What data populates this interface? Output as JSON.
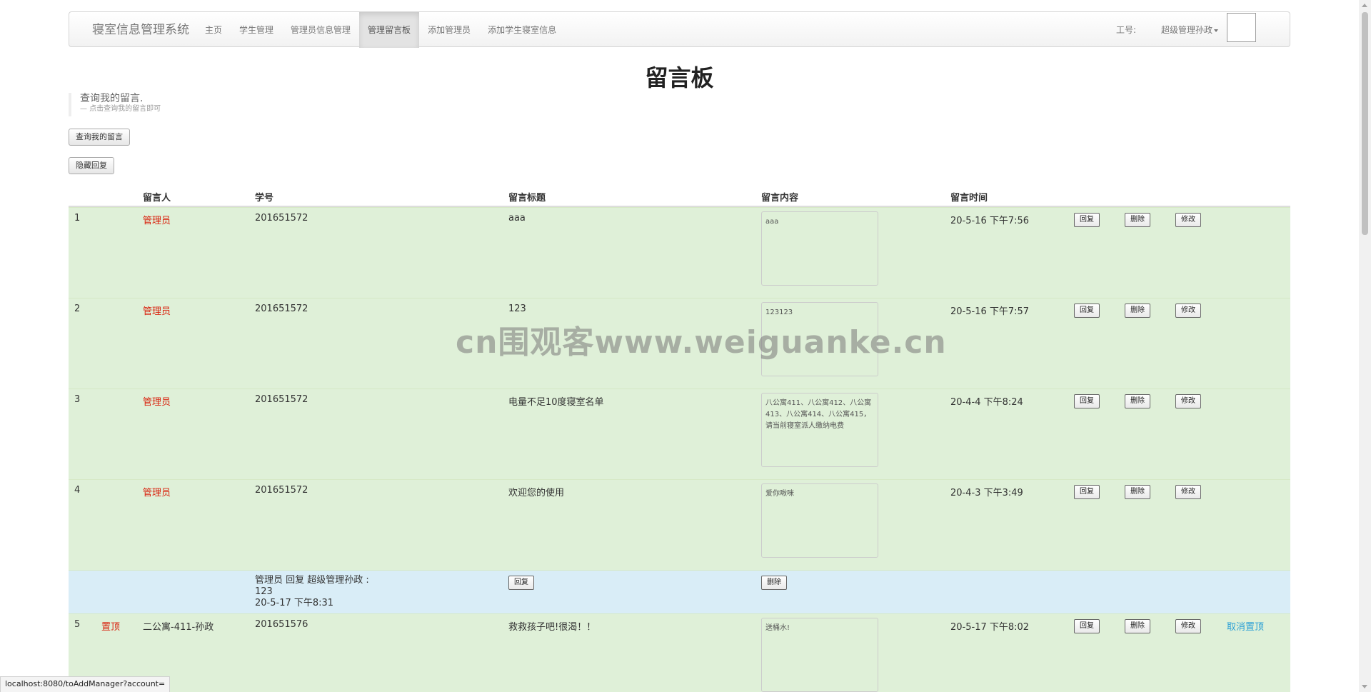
{
  "navbar": {
    "brand": "寝室信息管理系统",
    "items": [
      {
        "label": "主页"
      },
      {
        "label": "学生管理"
      },
      {
        "label": "管理员信息管理"
      },
      {
        "label": "管理留言板"
      },
      {
        "label": "添加管理员"
      },
      {
        "label": "添加学生寝室信息"
      }
    ],
    "active_index": 3,
    "gonghao_label": "工号:",
    "user_label": "超级管理孙政",
    "avatar_icon": "broken-image-icon"
  },
  "page": {
    "title": "留言板",
    "quote_main": "查询我的留言.",
    "quote_sub": "— 点击查询我的留言即可",
    "btn_my_messages": "查询我的留言",
    "btn_hide_reply": "隐藏回复"
  },
  "table": {
    "headers": {
      "author": "留言人",
      "student_id": "学号",
      "title": "留言标题",
      "content": "留言内容",
      "time": "留言时间"
    },
    "rows": [
      {
        "index": "1",
        "pin": "",
        "author": "管理员",
        "student_id": "201651572",
        "title": "aaa",
        "content": "aaa",
        "time": "20-5-16 下午7:56",
        "reply": "回复",
        "delete": "删除",
        "edit": "修改",
        "extra": ""
      },
      {
        "index": "2",
        "pin": "",
        "author": "管理员",
        "student_id": "201651572",
        "title": "123",
        "content": "123123",
        "time": "20-5-16 下午7:57",
        "reply": "回复",
        "delete": "删除",
        "edit": "修改",
        "extra": ""
      },
      {
        "index": "3",
        "pin": "",
        "author": "管理员",
        "student_id": "201651572",
        "title": "电量不足10度寝室名单",
        "content": "八公寓411、八公寓412、八公寓413、八公寓414、八公寓415，请当前寝室派人缴纳电费",
        "time": "20-4-4 下午8:24",
        "reply": "回复",
        "delete": "删除",
        "edit": "修改",
        "extra": ""
      },
      {
        "index": "4",
        "pin": "",
        "author": "管理员",
        "student_id": "201651572",
        "title": "欢迎您的使用",
        "content": "爱你啾咪",
        "time": "20-4-3 下午3:49",
        "reply": "回复",
        "delete": "删除",
        "edit": "修改",
        "extra": ""
      }
    ],
    "reply_row": {
      "line1": "管理员 回复 超级管理孙政 :",
      "line2": "123",
      "line3": "20-5-17 下午8:31",
      "reply": "回复",
      "delete": "删除"
    },
    "row5": {
      "index": "5",
      "pin": "置顶",
      "author": "二公寓-411-孙政",
      "student_id": "201651576",
      "title": "救救孩子吧!很渴！！",
      "content": "送桶水!",
      "time": "20-5-17 下午8:02",
      "reply": "回复",
      "delete": "删除",
      "edit": "修改",
      "extra": "取消置顶"
    }
  },
  "watermark": "cn围观客www.weiguanke.cn",
  "statusbar": "localhost:8080/toAddManager?account="
}
